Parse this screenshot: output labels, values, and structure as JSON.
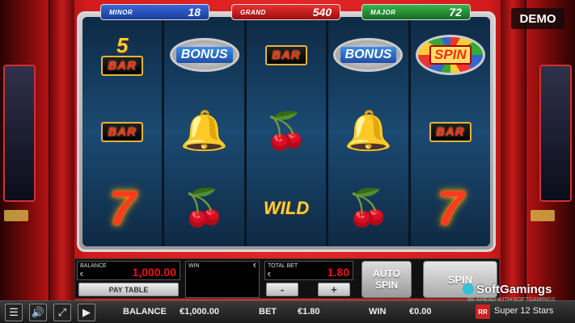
{
  "jackpots": {
    "minor": {
      "label": "MINOR",
      "value": "18"
    },
    "grand": {
      "label": "GRAND",
      "value": "540"
    },
    "major": {
      "label": "MAJOR",
      "value": "72"
    }
  },
  "demo_label": "DEMO",
  "reels": [
    [
      "5 BAR",
      "BAR",
      "7"
    ],
    [
      "BONUS",
      "bell",
      "cherry"
    ],
    [
      "BAR",
      "cherry",
      "WILD"
    ],
    [
      "BONUS",
      "bell",
      "cherry"
    ],
    [
      "SPIN",
      "BAR",
      "7"
    ]
  ],
  "panel": {
    "balance_label": "BALANCE",
    "balance_value": "1,000.00",
    "currency": "€",
    "paytable_label": "PAY TABLE",
    "win_label": "WIN",
    "totalbet_label": "TOTAL BET",
    "totalbet_value": "1.80",
    "minus_label": "-",
    "plus_label": "+",
    "autospin_line1": "AUTO",
    "autospin_line2": "SPIN",
    "spin_label": "SPIN"
  },
  "bottom": {
    "balance_label": "BALANCE",
    "balance_value": "€1,000.00",
    "bet_label": "BET",
    "bet_value": "€1.80",
    "win_label": "WIN",
    "win_value": "€0.00"
  },
  "branding": {
    "logo": "SoftGamings",
    "sub": "BE AHEAD WITH SOFTGAMINGS",
    "provider_badge": "RR",
    "game_name": "Super 12 Stars"
  },
  "icons": {
    "menu": "menu-icon",
    "sound": "sound-icon",
    "fullscreen": "fullscreen-icon",
    "video": "video-icon"
  }
}
